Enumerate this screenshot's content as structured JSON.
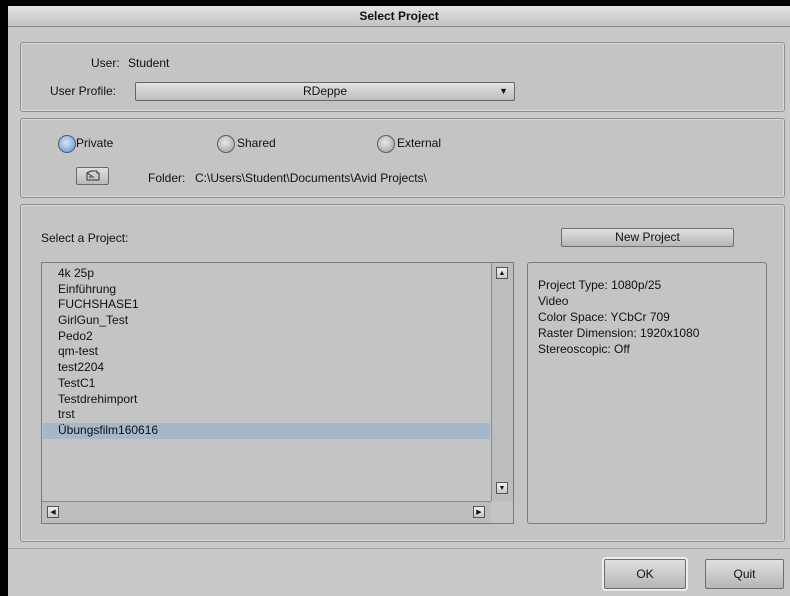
{
  "window": {
    "title": "Select Project"
  },
  "user": {
    "label": "User:",
    "value": "Student"
  },
  "profile": {
    "label": "User Profile:",
    "value": "RDeppe"
  },
  "location": {
    "options": [
      "Private",
      "Shared",
      "External"
    ],
    "selected": "Private",
    "folder_label": "Folder:",
    "folder_path": "C:\\Users\\Student\\Documents\\Avid Projects\\"
  },
  "projects": {
    "label": "Select a Project:",
    "items": [
      "4k 25p",
      "Einführung",
      "FUCHSHASE1",
      "GirlGun_Test",
      "Pedo2",
      "qm-test",
      "test2204",
      "TestC1",
      "Testdrehimport",
      "trst",
      "Übungsfilm160616"
    ],
    "selected_index": 10
  },
  "new_project_label": "New Project",
  "project_info": {
    "lines": [
      "Project Type: 1080p/25",
      "Video",
      "Color Space: YCbCr 709",
      "Raster Dimension: 1920x1080",
      "Stereoscopic: Off"
    ]
  },
  "buttons": {
    "ok": "OK",
    "quit": "Quit"
  },
  "icons": {
    "folder": "folder-browse-icon",
    "dropdown": "chevron-down-icon"
  },
  "colors": {
    "selection": "#a4b7cb",
    "radio_selected": "#5f8ec4"
  }
}
